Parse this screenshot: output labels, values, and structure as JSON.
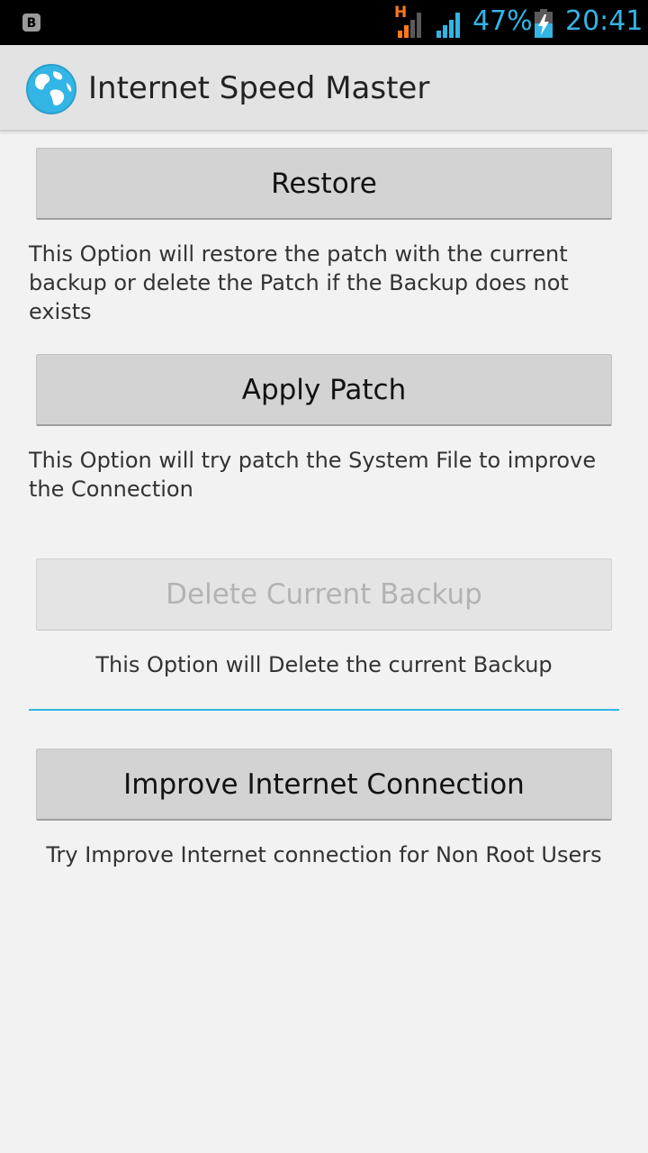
{
  "status_bar": {
    "network_type": "H",
    "battery_percent": "47%",
    "time": "20:41",
    "accent_color": "#33b5e5"
  },
  "action_bar": {
    "title": "Internet Speed Master",
    "icon": "globe-icon"
  },
  "options": [
    {
      "button_label": "Restore",
      "description": "This Option will restore the patch with the current backup or delete the Patch if the Backup does not exists",
      "enabled": true
    },
    {
      "button_label": "Apply Patch",
      "description": "This Option will try patch the System File to improve the Connection",
      "enabled": true
    },
    {
      "button_label": "Delete Current Backup",
      "description": "This Option will Delete the current Backup",
      "enabled": false
    },
    {
      "button_label": "Improve Internet Connection",
      "description": "Try Improve Internet connection for Non Root Users",
      "enabled": true
    }
  ]
}
